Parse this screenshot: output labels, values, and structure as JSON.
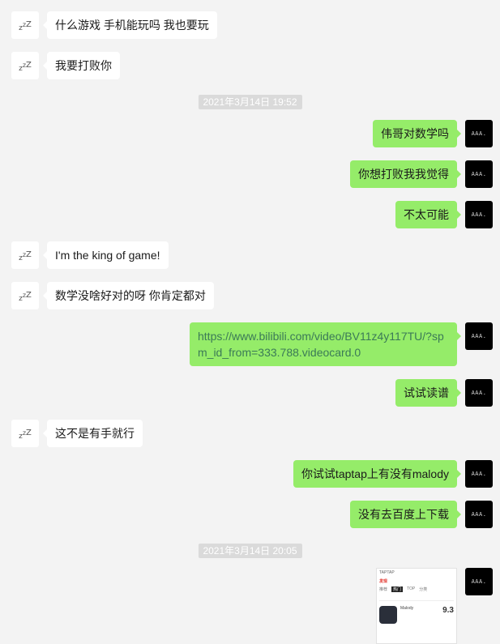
{
  "avatars": {
    "left_label": "zzZ",
    "right_label": "AAA."
  },
  "messages": [
    {
      "side": "left",
      "text": "什么游戏 手机能玩吗 我也要玩"
    },
    {
      "side": "left",
      "text": "我要打败你"
    },
    {
      "side": "time",
      "text": "2021年3月14日 19:52"
    },
    {
      "side": "right",
      "text": "伟哥对数学吗"
    },
    {
      "side": "right",
      "text": "你想打败我我觉得"
    },
    {
      "side": "right",
      "text": "不太可能"
    },
    {
      "side": "left",
      "text": "I'm the king of game!"
    },
    {
      "side": "left",
      "text": "数学没啥好对的呀 你肯定都对"
    },
    {
      "side": "right",
      "text": "https://www.bilibili.com/video/BV11z4y117TU/?spm_id_from=333.788.videocard.0"
    },
    {
      "side": "right",
      "text": "试试读谱"
    },
    {
      "side": "left",
      "text": "这不是有手就行"
    },
    {
      "side": "right",
      "text": "你试试taptap上有没有malody"
    },
    {
      "side": "right",
      "text": "没有去百度上下载"
    },
    {
      "side": "time",
      "text": "2021年3月14日 20:05"
    }
  ],
  "image_message": {
    "top_text": "TAPTAP",
    "brand_text": "发现",
    "tabs": [
      "推荐",
      "热门",
      "TOP",
      "分类",
      "节奏",
      "更多"
    ],
    "app_name": "Malody",
    "score": "9.3"
  }
}
